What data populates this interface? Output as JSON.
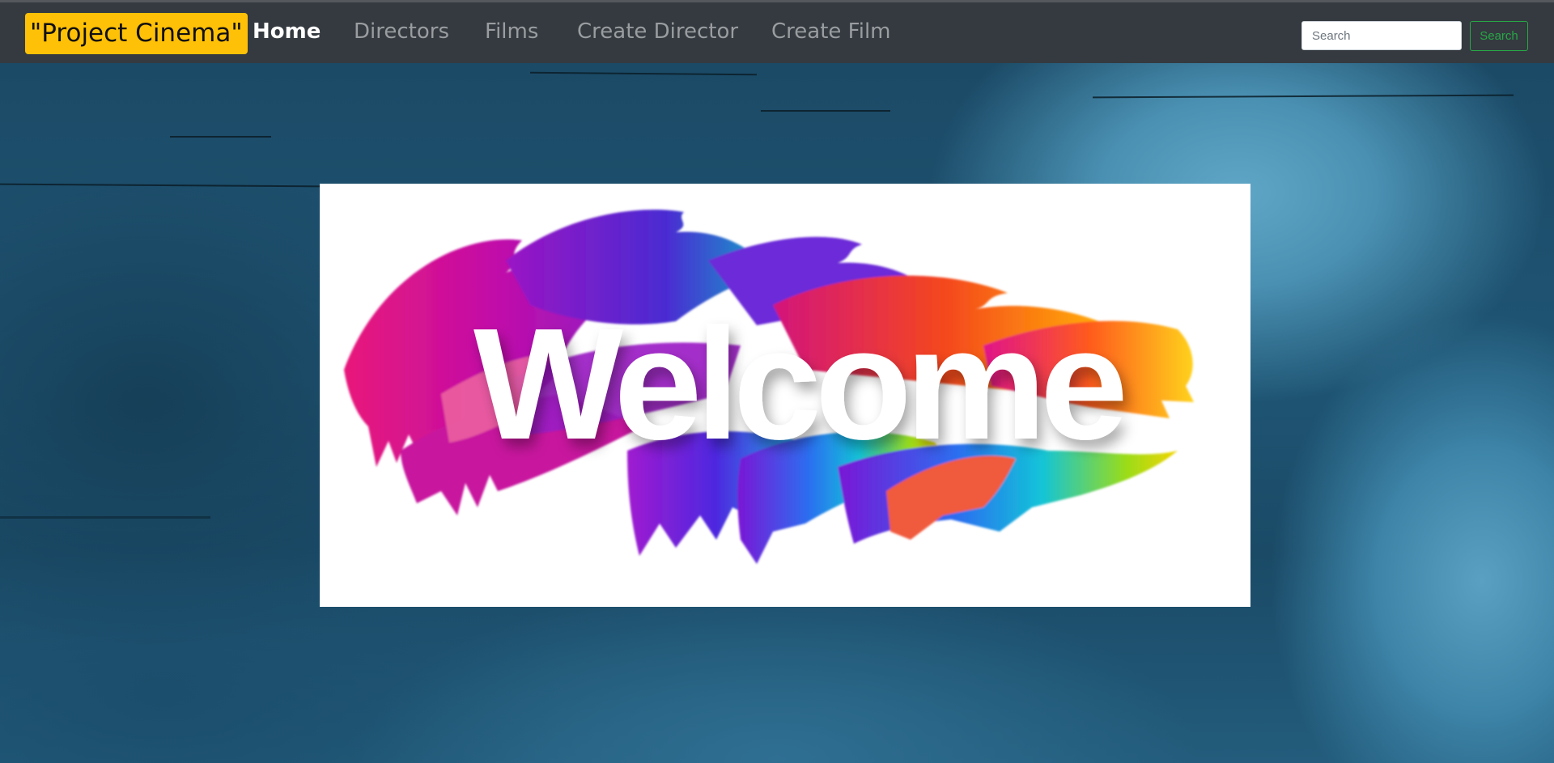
{
  "navbar": {
    "brand": "\"Project Cinema\"",
    "links": [
      {
        "label": "Home",
        "active": true
      },
      {
        "label": "Directors",
        "active": false
      },
      {
        "label": "Films",
        "active": false
      },
      {
        "label": "Create Director",
        "active": false
      },
      {
        "label": "Create Film",
        "active": false
      }
    ],
    "search": {
      "placeholder": "Search",
      "button_label": "Search"
    }
  },
  "banner": {
    "text": "Welcome"
  },
  "colors": {
    "navbar_bg": "#343a40",
    "brand_bg": "#ffc107",
    "search_button": "#28a745",
    "background": "#1f5574"
  }
}
